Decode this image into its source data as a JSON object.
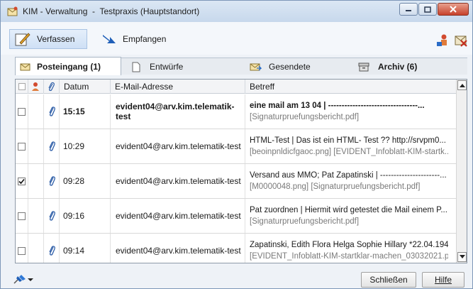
{
  "window": {
    "title": "KIM - Verwaltung  -  Testpraxis (Hauptstandort)"
  },
  "toolbar": {
    "compose_label": "Verfassen",
    "receive_label": "Empfangen"
  },
  "tabs": [
    {
      "label": "Posteingang (1)",
      "active": true
    },
    {
      "label": "Entwürfe",
      "active": false
    },
    {
      "label": "Gesendete",
      "active": false
    },
    {
      "label": "Archiv (6)",
      "active": false
    }
  ],
  "table": {
    "columns": {
      "date": "Datum",
      "email": "E-Mail-Adresse",
      "subject": "Betreff"
    },
    "rows": [
      {
        "checked": false,
        "time": "15:15",
        "email": "evident04@arv.kim.telematik-test",
        "subject": "eine mail am 13 04  |  ---------------------------------...",
        "attachments": "[Signaturpruefungsbericht.pdf]",
        "unread": true
      },
      {
        "checked": false,
        "time": "10:29",
        "email": "evident04@arv.kim.telematik-test",
        "subject": "HTML-Test  |  Das ist ein HTML- Test ?? http://srvpm0...",
        "attachments": "[beoinpnldicfgaoc.png] [EVIDENT_Infoblatt-KIM-startk...",
        "unread": false
      },
      {
        "checked": true,
        "time": "09:28",
        "email": "evident04@arv.kim.telematik-test",
        "subject": "Versand aus MMO; Pat Zapatinski  |  ----------------------...",
        "attachments": "[M0000048.png] [Signaturpruefungsbericht.pdf]",
        "unread": false
      },
      {
        "checked": false,
        "time": "09:16",
        "email": "evident04@arv.kim.telematik-test",
        "subject": "Pat zuordnen  |  Hiermit wird getestet die Mail einem P...",
        "attachments": "[Signaturpruefungsbericht.pdf]",
        "unread": false
      },
      {
        "checked": false,
        "time": "09:14",
        "email": "evident04@arv.kim.telematik-test",
        "subject": "Zapatinski, Edith Flora Helga Sophie Hillary *22.04.1943...",
        "attachments": "[EVIDENT_Infoblatt-KIM-startklar-machen_03032021.p...",
        "unread": false
      }
    ]
  },
  "footer": {
    "close_label": "Schließen",
    "help_label": "Hilfe"
  },
  "colors": {
    "accent": "#a9c3e3",
    "attachment_clip": "#2f5fa8",
    "frame": "#7d97b8"
  }
}
